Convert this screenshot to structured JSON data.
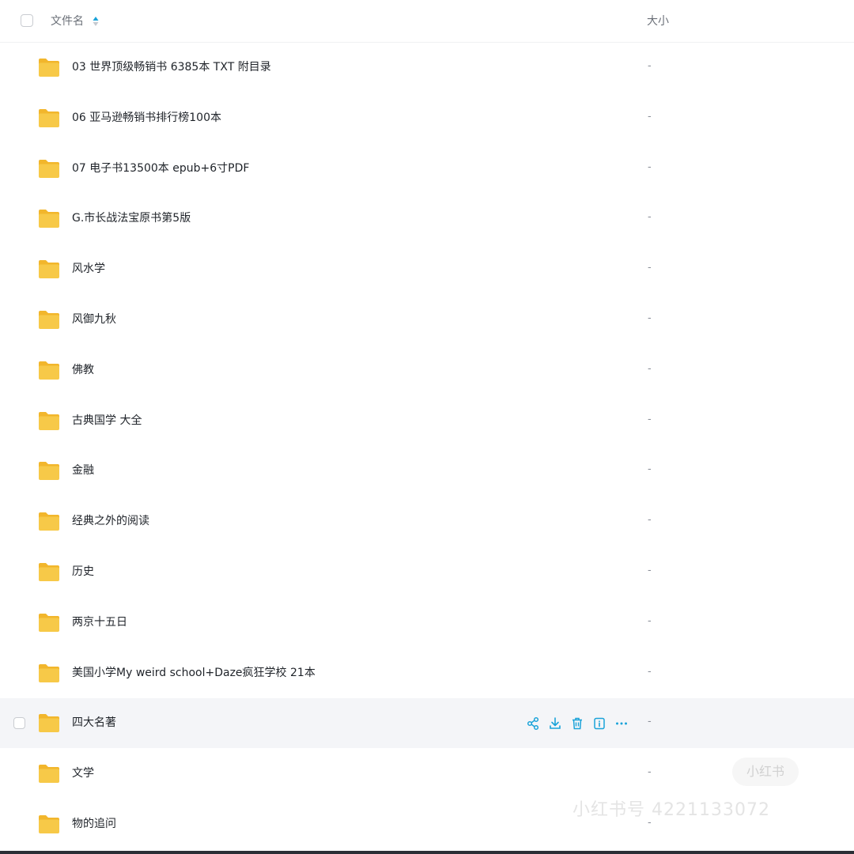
{
  "header": {
    "name_label": "文件名",
    "size_label": "大小"
  },
  "files": [
    {
      "name": "03 世界顶级畅销书 6385本 TXT 附目录",
      "size": "-"
    },
    {
      "name": "06 亚马逊畅销书排行榜100本",
      "size": "-"
    },
    {
      "name": "07 电子书13500本 epub+6寸PDF",
      "size": "-"
    },
    {
      "name": "G.市长战法宝原书第5版",
      "size": "-"
    },
    {
      "name": "风水学",
      "size": "-"
    },
    {
      "name": "风御九秋",
      "size": "-"
    },
    {
      "name": "佛教",
      "size": "-"
    },
    {
      "name": "古典国学 大全",
      "size": "-"
    },
    {
      "name": "金融",
      "size": "-"
    },
    {
      "name": "经典之外的阅读",
      "size": "-"
    },
    {
      "name": "历史",
      "size": "-"
    },
    {
      "name": "两京十五日",
      "size": "-"
    },
    {
      "name": "美国小学My weird school+Daze疯狂学校 21本",
      "size": "-"
    },
    {
      "name": "四大名著",
      "size": "-"
    },
    {
      "name": "文学",
      "size": "-"
    },
    {
      "name": "物的追问",
      "size": "-"
    }
  ],
  "hovered_row_actions": [
    "share-icon",
    "download-icon",
    "delete-icon",
    "info-icon",
    "more-icon"
  ],
  "watermark": {
    "logo": "小红书",
    "id_text": "小红书号 4221133072"
  },
  "colors": {
    "folder": "#f7c948",
    "folder_back": "#f2b62c",
    "accent": "#1aa3d9",
    "hover_bg": "#f4f5f8"
  }
}
